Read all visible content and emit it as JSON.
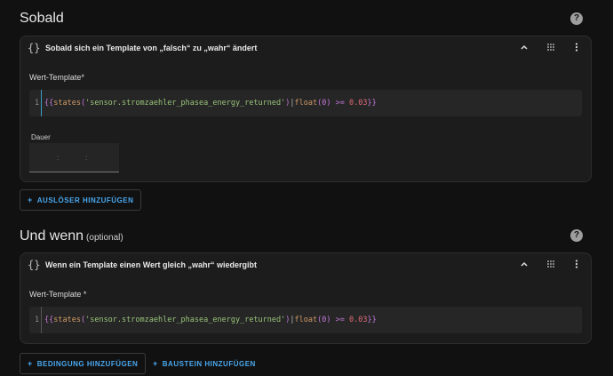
{
  "section1": {
    "title": "Sobald",
    "help": "?"
  },
  "card1": {
    "icon": "{}",
    "title": "Sobald sich ein Template von „falsch“ zu „wahr“ ändert",
    "field_label": "Wert-Template*",
    "code_line_no": "1",
    "duration_label": "Dauer",
    "duration_sep1": ":",
    "duration_sep2": ":"
  },
  "add_trigger_button": "AUSLÖSER HINZUFÜGEN",
  "section2": {
    "title": "Und wenn",
    "optional": "(optional)",
    "help": "?"
  },
  "card2": {
    "icon": "{}",
    "title": "Wenn ein Template einen Wert gleich „wahr“ wiedergibt",
    "field_label": "Wert-Template *",
    "code_line_no": "1"
  },
  "code": {
    "open": "{{",
    "fn": "states",
    "lparen": "(",
    "str": "'sensor.stromzaehler_phasea_energy_returned'",
    "rparen": ")",
    "pipe": "|",
    "filter": "float",
    "farg": "(0)",
    "op": ">=",
    "num": "0.03",
    "close": "}}"
  },
  "add_condition_button": "BEDINGUNG HINZUFÜGEN",
  "add_block_button": "BAUSTEIN HINZUFÜGEN",
  "icons": [
    "help-icon",
    "braces-icon",
    "chevron-up-icon",
    "drag-handle-icon",
    "more-vert-icon",
    "plus-icon"
  ]
}
